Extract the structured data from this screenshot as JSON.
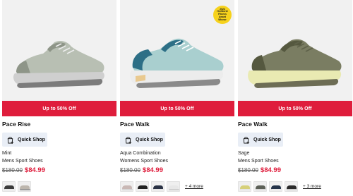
{
  "products": [
    {
      "name": "Pace Rise",
      "badge": "Up to 50% Off",
      "quick_shop": "Quick Shop",
      "color": "Mint",
      "category": "Mens Sport Shoes",
      "old_price": "$180.00",
      "new_price": "$84.99",
      "more": "",
      "award_text": "",
      "shoe": {
        "upper": "#b8bfb3",
        "trim": "#8e9588",
        "midsole": "#cfcfcf",
        "outsole": "#7c7c7c"
      },
      "swatches": [
        {
          "upper": "#3b3b3b",
          "sole": "#e8e8e8"
        },
        {
          "upper": "#bdb6ad",
          "sole": "#9a9a9a"
        }
      ]
    },
    {
      "name": "Pace Walk",
      "badge": "Up to 50% Off",
      "quick_shop": "Quick Shop",
      "color": "Aqua Combination",
      "category": "Womens Sport Shoes",
      "old_price": "$180.00",
      "new_price": "$84.99",
      "more": "+ 4 more",
      "award_text": "2024 HerWorld Fitness Award Winner",
      "shoe": {
        "upper": "#a9cfcf",
        "trim": "#2d6f86",
        "midsole": "#ececec",
        "outsole": "#8a8a8a"
      },
      "swatches": [
        {
          "upper": "#c9b8b5",
          "sole": "#d7d7d7"
        },
        {
          "upper": "#232323",
          "sole": "#f0f0f0"
        },
        {
          "upper": "#2b3345",
          "sole": "#e6e6e6"
        },
        {
          "upper": "#e7e7e7",
          "sole": "#cfcfcf"
        }
      ]
    },
    {
      "name": "Pace Walk",
      "badge": "Up to 50% Off",
      "quick_shop": "Quick Shop",
      "color": "Sage",
      "category": "Mens Sport Shoes",
      "old_price": "$180.00",
      "new_price": "$84.99",
      "more": "+ 3 more",
      "award_text": "",
      "shoe": {
        "upper": "#7a7d62",
        "trim": "#55583f",
        "midsole": "#e9eab2",
        "outsole": "#6d6d55"
      },
      "swatches": [
        {
          "upper": "#d6d07a",
          "sole": "#e6e6e6"
        },
        {
          "upper": "#5c6057",
          "sole": "#d9d9d9"
        },
        {
          "upper": "#243349",
          "sole": "#e9e9e9"
        },
        {
          "upper": "#2a2a2a",
          "sole": "#d0d0d0"
        }
      ]
    }
  ]
}
